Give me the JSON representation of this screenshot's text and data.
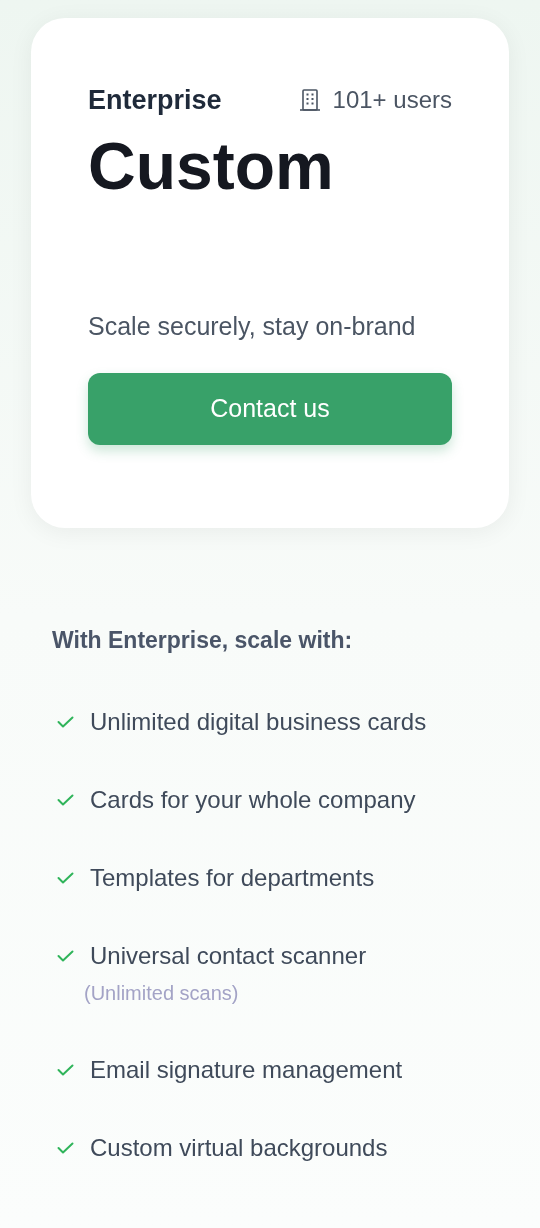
{
  "plan": {
    "name": "Enterprise",
    "users": "101+ users",
    "price": "Custom",
    "tagline": "Scale securely, stay on-brand",
    "button": "Contact us"
  },
  "features": {
    "heading": "With Enterprise, scale with:",
    "items": [
      {
        "label": "Unlimited digital business cards"
      },
      {
        "label": "Cards for your whole company"
      },
      {
        "label": "Templates for departments"
      },
      {
        "label": "Universal contact scanner",
        "note": "(Unlimited scans)"
      },
      {
        "label": "Email signature management"
      },
      {
        "label": "Custom virtual backgrounds"
      }
    ]
  }
}
